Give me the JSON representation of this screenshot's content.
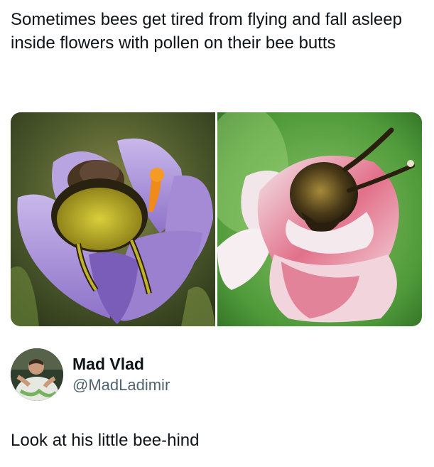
{
  "post": {
    "text": "Sometimes bees get tired from flying and fall asleep inside flowers with pollen on their bee butts"
  },
  "media": {
    "images": [
      {
        "icon": "bee-in-purple-crocus-photo"
      },
      {
        "icon": "bee-in-pink-flower-photo"
      }
    ]
  },
  "author": {
    "name": "Mad Vlad",
    "handle": "@MadLadimir",
    "avatar_icon": "avatar-photo"
  },
  "reply": {
    "text": "Look at his little bee-hind"
  },
  "colors": {
    "text_primary": "#0f1419",
    "text_secondary": "#536471",
    "background": "#ffffff"
  }
}
